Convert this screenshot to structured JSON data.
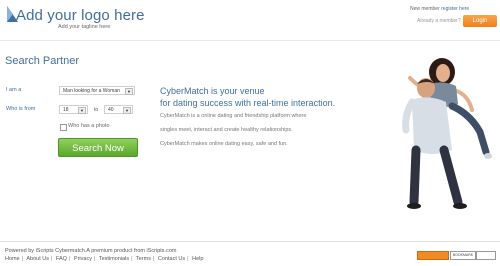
{
  "header": {
    "logo_text": "Add your logo here",
    "tagline": "Add your tagline here",
    "new_member_text": "New member",
    "register_link": "register here",
    "already_member_text": "Already a member?",
    "login_label": "Login"
  },
  "search": {
    "title": "Search Partner",
    "i_am_label": "I am a",
    "looking_for_value": "Man looking for a Woman",
    "who_is_from_label": "Who is from",
    "age_from_value": "18",
    "to_label": "to",
    "age_to_value": "40",
    "has_photo_label": "Who has a photo",
    "search_button_label": "Search Now"
  },
  "pitch": {
    "heading_line1": "CyberMatch is your venue",
    "heading_line2": "for dating success with real-time interaction.",
    "line1": "CyberMatch is a online dating and friendship platform where",
    "line2": "singles meet, interact and create healthy relationships.",
    "line3": "CyberMatch makes online dating easy, safe and fun."
  },
  "footer": {
    "powered_by": "Powered by iScripts Cybermatch.A premium product from iScripts.com",
    "links": [
      "Home",
      "About Us",
      "FAQ",
      "Privacy",
      "Testimonials",
      "Terms",
      "Contact Us",
      "Help"
    ],
    "bookmark_label": "BOOKMARK"
  },
  "colors": {
    "brand_blue": "#3f6f9c",
    "login_orange": "#f07f1c",
    "search_green": "#5aa82e"
  }
}
